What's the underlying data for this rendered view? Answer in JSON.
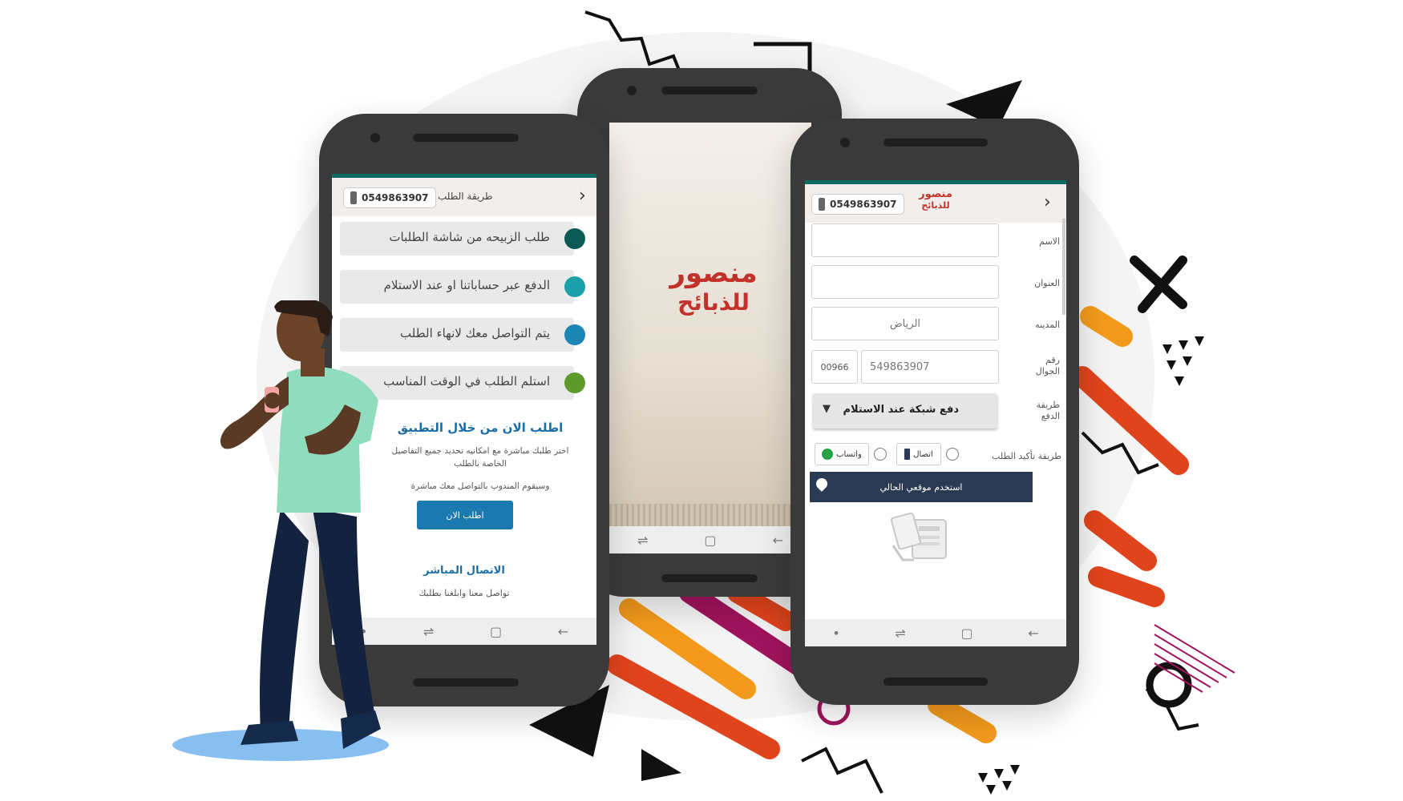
{
  "colors": {
    "teal": "#0b6b63",
    "phone_body": "#3a3a3a",
    "button_blue": "#1a7ab0",
    "dark_navy": "#2a3a52",
    "orange": "#f39a1c",
    "red": "#e0441c",
    "magenta": "#a0135d"
  },
  "left_phone": {
    "header": {
      "phone_number": "0549863907",
      "title": "طريقة الطلب",
      "back_icon": "chevron-right-icon"
    },
    "steps": [
      {
        "text": "طلب الزبيحه من شاشة الطلبات",
        "color": "#0c5a55"
      },
      {
        "text": "الدفع عبر حساباتنا او عند الاستلام",
        "color": "#1aa0a8"
      },
      {
        "text": "يتم التواصل معك لانهاء الطلب",
        "color": "#1c86b5"
      },
      {
        "text": "استلم الطلب في الوقت المناسب",
        "color": "#5e9a2b"
      }
    ],
    "order_title": "اطلب الان من خلال التطبيق",
    "order_desc_1": "اختر طلبك مباشرة مع امكانيه تحديد جميع التفاصيل",
    "order_desc_2": "الخاصة بالطلب",
    "order_desc_3": "وسيقوم المندوب بالتواصل معك مباشرة",
    "order_button": "اطلب الان",
    "contact_title": "الاتصال المباشر",
    "contact_desc": "تواصل معنا وابلغنا بطلبك"
  },
  "center_phone": {
    "logo_line_1": "منصور",
    "logo_line_2": "للذبائح"
  },
  "right_phone": {
    "header": {
      "phone_number": "0549863907",
      "logo_line_1": "منصور",
      "logo_line_2": "للذبائح",
      "back_icon": "chevron-right-icon"
    },
    "labels": {
      "name": "الاسم",
      "address": "العنوان",
      "city": "المدينه",
      "mobile_1": "رقم",
      "mobile_2": "الجوال",
      "payment_1": "طريقة",
      "payment_2": "الدفع",
      "confirm": "طريقة تأكيد الطلب"
    },
    "city_placeholder": "الرياض",
    "country_code": "00966",
    "mobile_value": "549863907",
    "payment_selected": "دفع شبكة عند الاستلام",
    "confirm_call": "اتصال",
    "confirm_whatsapp": "واتساب",
    "location_button": "استخدم موقعي الحالي"
  }
}
